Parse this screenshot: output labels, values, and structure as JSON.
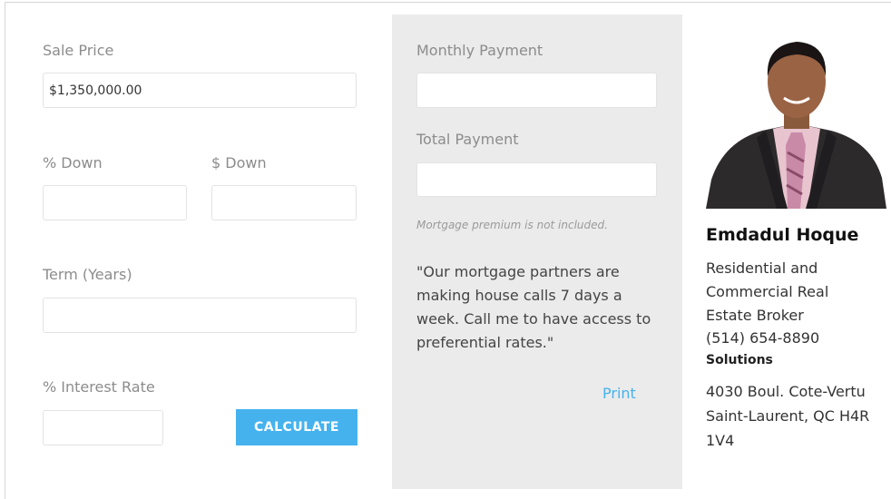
{
  "calculator": {
    "sale_price_label": "Sale Price",
    "sale_price_value": "$1,350,000.00",
    "pct_down_label": "% Down",
    "pct_down_value": "",
    "amt_down_label": "$ Down",
    "amt_down_value": "",
    "term_label": "Term (Years)",
    "term_value": "",
    "interest_label": "% Interest Rate",
    "interest_value": "",
    "calculate_label": "CALCULATE"
  },
  "results": {
    "monthly_label": "Monthly Payment",
    "monthly_value": "",
    "total_label": "Total Payment",
    "total_value": "",
    "note": "Mortgage premium is not included.",
    "quote": "\"Our mortgage partners are making house calls 7 days a week. Call me to have access to preferential rates.\"",
    "print_label": "Print"
  },
  "agent": {
    "name": "Emdadul Hoque",
    "title": "Residential and Commercial Real Estate Broker",
    "phone": "(514) 654-8890",
    "company": "Solutions",
    "address_line1": "4030 Boul. Cote-Vertu",
    "address_line2": "Saint-Laurent, QC H4R 1V4"
  },
  "colors": {
    "accent": "#45b2ee",
    "panel_bg": "#ebebeb",
    "label": "#8c8c8c"
  }
}
